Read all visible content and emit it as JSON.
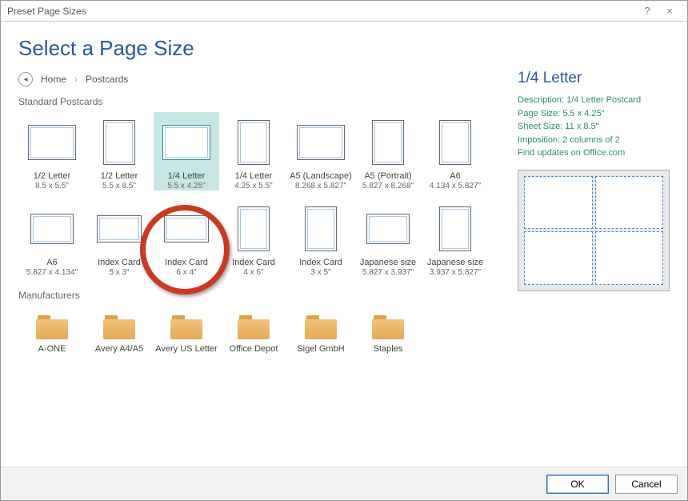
{
  "window": {
    "title": "Preset Page Sizes",
    "help": "?",
    "close": "×"
  },
  "heading": "Select a Page Size",
  "breadcrumb": {
    "back": "◂",
    "home": "Home",
    "sep": "›",
    "current": "Postcards"
  },
  "sections": {
    "standard": "Standard Postcards",
    "manufacturers": "Manufacturers"
  },
  "items": [
    {
      "name": "1/2 Letter",
      "size": "8.5 x 5.5\"",
      "shape": "land"
    },
    {
      "name": "1/2 Letter",
      "size": "5.5 x 8.5\"",
      "shape": "port"
    },
    {
      "name": "1/4 Letter",
      "size": "5.5 x 4.25\"",
      "shape": "land",
      "selected": true
    },
    {
      "name": "1/4 Letter",
      "size": "4.25 x 5.5\"",
      "shape": "port"
    },
    {
      "name": "A5 (Landscape)",
      "size": "8.268 x 5.827\"",
      "shape": "land"
    },
    {
      "name": "A5 (Portrait)",
      "size": "5.827 x 8.268\"",
      "shape": "port"
    },
    {
      "name": "A6",
      "size": "4.134 x 5.827\"",
      "shape": "port"
    },
    {
      "name": "A6",
      "size": "5.827 x 4.134\"",
      "shape": "land-sm"
    },
    {
      "name": "Index Card",
      "size": "5 x 3\"",
      "shape": "idx"
    },
    {
      "name": "Index Card",
      "size": "6 x 4\"",
      "shape": "idx"
    },
    {
      "name": "Index Card",
      "size": "4 x 6\"",
      "shape": "port"
    },
    {
      "name": "Index Card",
      "size": "3 x 5\"",
      "shape": "port"
    },
    {
      "name": "Japanese size",
      "size": "5.827 x 3.937\"",
      "shape": "land-sm"
    },
    {
      "name": "Japanese size",
      "size": "3.937 x 5.827\"",
      "shape": "port"
    }
  ],
  "folders": [
    {
      "name": "A-ONE"
    },
    {
      "name": "Avery A4/A5"
    },
    {
      "name": "Avery US Letter"
    },
    {
      "name": "Office Depot"
    },
    {
      "name": "Sigel GmbH"
    },
    {
      "name": "Staples"
    }
  ],
  "detail": {
    "title": "1/4 Letter",
    "lines": [
      "Description: 1/4 Letter Postcard",
      "Page Size: 5.5 x 4.25\"",
      "Sheet Size: 11 x 8.5\"",
      "Imposition: 2 columns of 2"
    ],
    "link": "Find updates on Office.com"
  },
  "buttons": {
    "ok": "OK",
    "cancel": "Cancel"
  }
}
